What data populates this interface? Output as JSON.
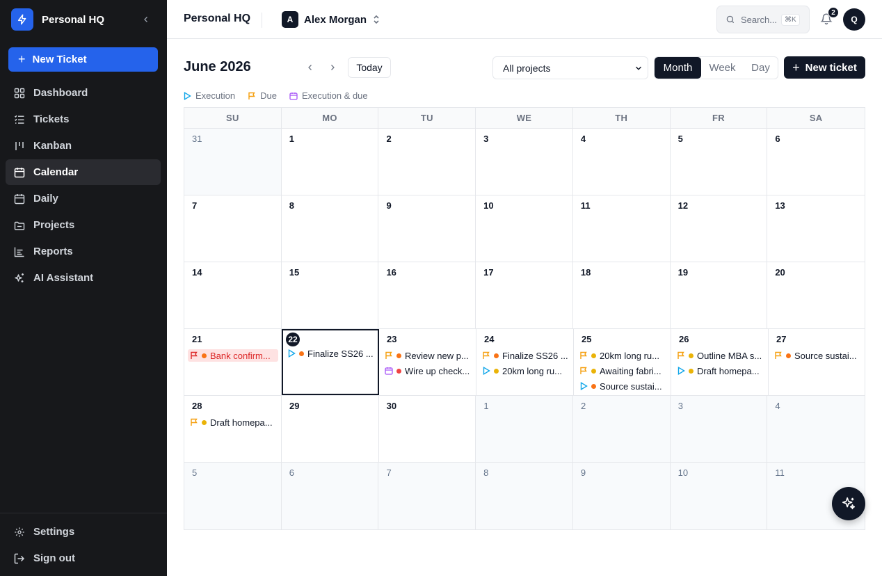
{
  "sidebar": {
    "brand": "Personal HQ",
    "new_ticket": "New Ticket",
    "items": [
      {
        "label": "Dashboard",
        "icon": "dashboard-icon"
      },
      {
        "label": "Tickets",
        "icon": "list-icon"
      },
      {
        "label": "Kanban",
        "icon": "kanban-icon"
      },
      {
        "label": "Calendar",
        "icon": "calendar-icon",
        "active": true
      },
      {
        "label": "Daily",
        "icon": "calendar-day-icon"
      },
      {
        "label": "Projects",
        "icon": "folder-icon"
      },
      {
        "label": "Reports",
        "icon": "chart-icon"
      },
      {
        "label": "AI Assistant",
        "icon": "sparkles-icon"
      }
    ],
    "bottom": [
      {
        "label": "Settings",
        "icon": "gear-icon"
      },
      {
        "label": "Sign out",
        "icon": "sign-out-icon"
      }
    ]
  },
  "header": {
    "title": "Personal HQ",
    "workspace_initial": "A",
    "workspace_name": "Alex Morgan",
    "search_placeholder": "Search...",
    "search_shortcut": "⌘K",
    "notification_count": "2",
    "user_initial": "Q"
  },
  "toolbar": {
    "month_title": "June 2026",
    "today": "Today",
    "project_filter": "All projects",
    "views": [
      "Month",
      "Week",
      "Day"
    ],
    "active_view": "Month",
    "new_ticket": "New ticket"
  },
  "legend": {
    "execution": "Execution",
    "due": "Due",
    "execution_due": "Execution & due"
  },
  "colors": {
    "accent": "#2563eb",
    "dark": "#111827",
    "execution": "#0ea5e9",
    "due": "#f59e0b",
    "execution_due": "#a855f7",
    "priority_high": "#f97316",
    "priority_medium": "#eab308",
    "priority_urgent": "#ef4444",
    "overdue_bg": "#fee2e2"
  },
  "calendar": {
    "days_of_week": [
      "SU",
      "MO",
      "TU",
      "WE",
      "TH",
      "FR",
      "SA"
    ],
    "weeks": [
      [
        {
          "day": "31",
          "other": true,
          "events": []
        },
        {
          "day": "1",
          "events": []
        },
        {
          "day": "2",
          "events": []
        },
        {
          "day": "3",
          "events": []
        },
        {
          "day": "4",
          "events": []
        },
        {
          "day": "5",
          "events": []
        },
        {
          "day": "6",
          "events": []
        }
      ],
      [
        {
          "day": "7",
          "events": []
        },
        {
          "day": "8",
          "events": []
        },
        {
          "day": "9",
          "events": []
        },
        {
          "day": "10",
          "events": []
        },
        {
          "day": "11",
          "events": []
        },
        {
          "day": "12",
          "events": []
        },
        {
          "day": "13",
          "events": []
        }
      ],
      [
        {
          "day": "14",
          "events": []
        },
        {
          "day": "15",
          "events": []
        },
        {
          "day": "16",
          "events": []
        },
        {
          "day": "17",
          "events": []
        },
        {
          "day": "18",
          "events": []
        },
        {
          "day": "19",
          "events": []
        },
        {
          "day": "20",
          "events": []
        }
      ],
      [
        {
          "day": "21",
          "events": [
            {
              "kind": "due",
              "priority": "high",
              "title": "Bank confirm...",
              "overdue": true
            }
          ]
        },
        {
          "day": "22",
          "today": true,
          "events": [
            {
              "kind": "execution",
              "priority": "high",
              "title": "Finalize SS26 ..."
            }
          ]
        },
        {
          "day": "23",
          "events": [
            {
              "kind": "due",
              "priority": "high",
              "title": "Review new p..."
            },
            {
              "kind": "execution_due",
              "priority": "urgent",
              "title": "Wire up check..."
            }
          ]
        },
        {
          "day": "24",
          "events": [
            {
              "kind": "due",
              "priority": "high",
              "title": "Finalize SS26 ..."
            },
            {
              "kind": "execution",
              "priority": "medium",
              "title": "20km long ru..."
            }
          ]
        },
        {
          "day": "25",
          "events": [
            {
              "kind": "due",
              "priority": "medium",
              "title": "20km long ru..."
            },
            {
              "kind": "due",
              "priority": "medium",
              "title": "Awaiting fabri..."
            },
            {
              "kind": "execution",
              "priority": "high",
              "title": "Source sustai..."
            }
          ]
        },
        {
          "day": "26",
          "events": [
            {
              "kind": "due",
              "priority": "medium",
              "title": "Outline MBA s..."
            },
            {
              "kind": "execution",
              "priority": "medium",
              "title": "Draft homepa..."
            }
          ]
        },
        {
          "day": "27",
          "events": [
            {
              "kind": "due",
              "priority": "high",
              "title": "Source sustai..."
            }
          ]
        }
      ],
      [
        {
          "day": "28",
          "events": [
            {
              "kind": "due",
              "priority": "medium",
              "title": "Draft homepa..."
            }
          ]
        },
        {
          "day": "29",
          "events": []
        },
        {
          "day": "30",
          "events": []
        },
        {
          "day": "1",
          "other": true,
          "events": []
        },
        {
          "day": "2",
          "other": true,
          "events": []
        },
        {
          "day": "3",
          "other": true,
          "events": []
        },
        {
          "day": "4",
          "other": true,
          "events": []
        }
      ],
      [
        {
          "day": "5",
          "other": true,
          "events": []
        },
        {
          "day": "6",
          "other": true,
          "events": []
        },
        {
          "day": "7",
          "other": true,
          "events": []
        },
        {
          "day": "8",
          "other": true,
          "events": []
        },
        {
          "day": "9",
          "other": true,
          "events": []
        },
        {
          "day": "10",
          "other": true,
          "events": []
        },
        {
          "day": "11",
          "other": true,
          "events": []
        }
      ]
    ]
  }
}
